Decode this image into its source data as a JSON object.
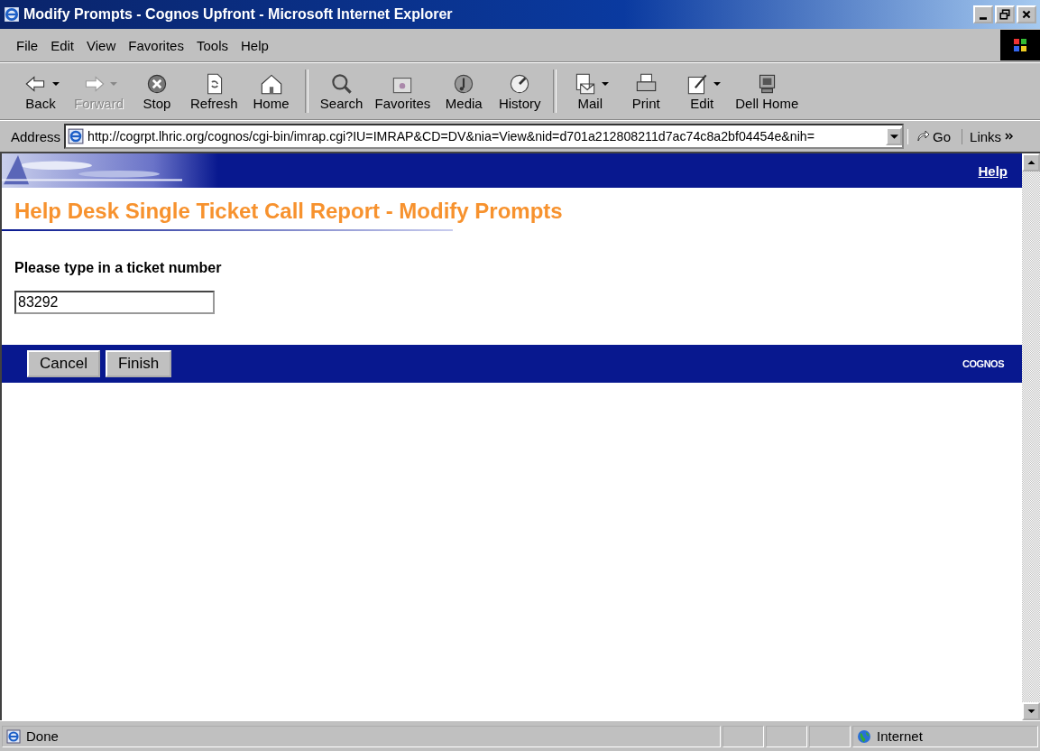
{
  "window": {
    "title": "Modify Prompts - Cognos Upfront - Microsoft Internet Explorer"
  },
  "menu": [
    "File",
    "Edit",
    "View",
    "Favorites",
    "Tools",
    "Help"
  ],
  "toolbar_groups": [
    {
      "buttons": [
        {
          "label": "Back",
          "kind": "back",
          "disabled": false,
          "dropdown": true
        },
        {
          "label": "Forward",
          "kind": "forward",
          "disabled": true,
          "dropdown": true
        },
        {
          "label": "Stop",
          "kind": "stop",
          "disabled": false,
          "dropdown": false
        },
        {
          "label": "Refresh",
          "kind": "refresh",
          "disabled": false,
          "dropdown": false
        },
        {
          "label": "Home",
          "kind": "home",
          "disabled": false,
          "dropdown": false
        }
      ]
    },
    {
      "buttons": [
        {
          "label": "Search",
          "kind": "search",
          "disabled": false,
          "dropdown": false
        },
        {
          "label": "Favorites",
          "kind": "favorites",
          "disabled": false,
          "dropdown": false
        },
        {
          "label": "Media",
          "kind": "media",
          "disabled": false,
          "dropdown": false
        },
        {
          "label": "History",
          "kind": "history",
          "disabled": false,
          "dropdown": false
        }
      ]
    },
    {
      "buttons": [
        {
          "label": "Mail",
          "kind": "mail",
          "disabled": false,
          "dropdown": true
        },
        {
          "label": "Print",
          "kind": "print",
          "disabled": false,
          "dropdown": false
        },
        {
          "label": "Edit",
          "kind": "edit",
          "disabled": false,
          "dropdown": true
        },
        {
          "label": "Dell Home",
          "kind": "computer",
          "disabled": false,
          "dropdown": false
        }
      ]
    }
  ],
  "address": {
    "label": "Address",
    "value": "http://cogrpt.lhric.org/cognos/cgi-bin/imrap.cgi?IU=IMRAP&CD=DV&nia=View&nid=d701a212808211d7ac74c8a2bf04454e&nih=",
    "go": "Go",
    "links": "Links"
  },
  "page": {
    "help_link": "Help",
    "heading": "Help Desk Single Ticket Call Report - Modify Prompts",
    "prompt": "Please type in a ticket number",
    "ticket_field": {
      "value": "83292"
    },
    "buttons": [
      "Cancel",
      "Finish"
    ],
    "brand": "COGNOS"
  },
  "status_bar": {
    "text": "Done",
    "zone": "Internet"
  }
}
